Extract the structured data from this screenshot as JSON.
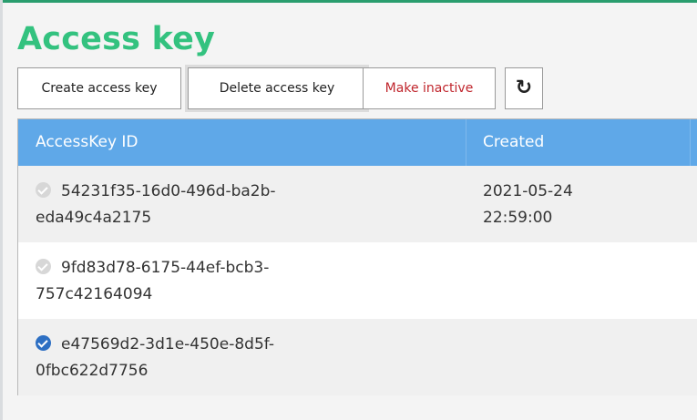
{
  "page": {
    "title": "Access key"
  },
  "toolbar": {
    "create_label": "Create access key",
    "delete_label": "Delete access key",
    "inactive_label": "Make inactive",
    "refresh_icon": "refresh-icon",
    "refresh_glyph": "↻"
  },
  "table": {
    "columns": [
      "AccessKey ID",
      "Created"
    ],
    "rows": [
      {
        "id_line1": "54231f35-16d0-496d-ba2b-",
        "id_line2": "eda49c4a2175",
        "created_line1": "2021-05-24",
        "created_line2": "22:59:00",
        "checked": false
      },
      {
        "id_line1": "9fd83d78-6175-44ef-bcb3-",
        "id_line2": "757c42164094",
        "created_line1": "",
        "created_line2": "",
        "checked": false
      },
      {
        "id_line1": "e47569d2-3d1e-450e-8d5f-",
        "id_line2": "0fbc622d7756",
        "created_line1": "",
        "created_line2": "",
        "checked": true
      }
    ]
  },
  "colors": {
    "title": "#33c27f",
    "header_bg": "#5fa8e8",
    "danger": "#c0262d",
    "check_active": "#2d6fc3"
  }
}
